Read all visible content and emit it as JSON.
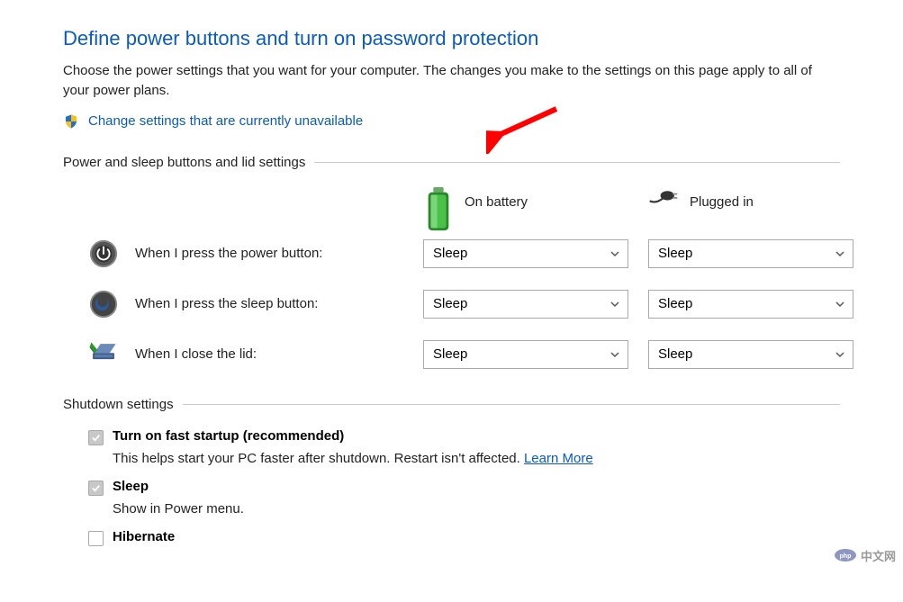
{
  "title": "Define power buttons and turn on password protection",
  "description": "Choose the power settings that you want for your computer. The changes you make to the settings on this page apply to all of your power plans.",
  "change_link": "Change settings that are currently unavailable",
  "section_power": "Power and sleep buttons and lid settings",
  "col_battery": "On battery",
  "col_plugged": "Plugged in",
  "rows": [
    {
      "label": "When I press the power button:",
      "battery": "Sleep",
      "plugged": "Sleep"
    },
    {
      "label": "When I press the sleep button:",
      "battery": "Sleep",
      "plugged": "Sleep"
    },
    {
      "label": "When I close the lid:",
      "battery": "Sleep",
      "plugged": "Sleep"
    }
  ],
  "section_shutdown": "Shutdown settings",
  "shutdown": [
    {
      "label": "Turn on fast startup (recommended)",
      "desc_pre": "This helps start your PC faster after shutdown. Restart isn't affected. ",
      "link": "Learn More",
      "checked": true
    },
    {
      "label": "Sleep",
      "desc_pre": "Show in Power menu.",
      "link": "",
      "checked": true
    },
    {
      "label": "Hibernate",
      "desc_pre": "",
      "link": "",
      "checked": false
    }
  ],
  "watermark": "中文网"
}
